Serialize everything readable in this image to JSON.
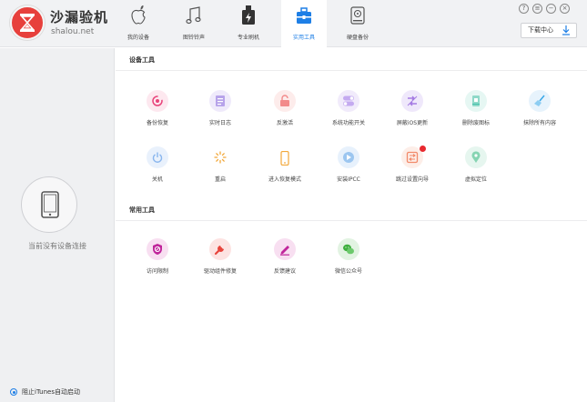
{
  "app": {
    "title": "沙漏验机",
    "url": "shalou.net"
  },
  "nav": {
    "tabs": [
      {
        "label": "我的设备",
        "icon": "apple-icon"
      },
      {
        "label": "图铃铃声",
        "icon": "music-note-icon"
      },
      {
        "label": "专业刷机",
        "icon": "phone-flash-icon"
      },
      {
        "label": "实用工具",
        "icon": "toolbox-icon"
      },
      {
        "label": "硬盘备份",
        "icon": "hard-drive-icon"
      }
    ],
    "active_tab": "实用工具"
  },
  "window_controls": [
    "help-icon",
    "menu-icon",
    "minimize-icon",
    "close-icon"
  ],
  "download_center": {
    "label": "下载中心",
    "icon": "download-icon"
  },
  "sidebar": {
    "device_icon": "tablet-icon",
    "no_device_text": "当前没有设备连接",
    "itunes_option": "阻止iTunes自动启动"
  },
  "sections": {
    "device_tools": {
      "title": "设备工具",
      "tools": [
        {
          "label": "备份恢复",
          "icon": "backup-restore-icon",
          "color": "#e8437a"
        },
        {
          "label": "实时日志",
          "icon": "log-icon",
          "color": "#8b6fd6"
        },
        {
          "label": "反激活",
          "icon": "unlock-icon",
          "color": "#f07a7a"
        },
        {
          "label": "系统功能开关",
          "icon": "toggle-icon",
          "color": "#a57be3"
        },
        {
          "label": "屏蔽iOS更新",
          "icon": "block-update-icon",
          "color": "#9a6fe0"
        },
        {
          "label": "删除废图标",
          "icon": "delete-icon-icon",
          "color": "#3fbfa9"
        },
        {
          "label": "抹除所有内容",
          "icon": "broom-icon",
          "color": "#38a8e8"
        },
        {
          "label": "关机",
          "icon": "power-icon",
          "color": "#6ea2e6"
        },
        {
          "label": "重启",
          "icon": "restart-icon",
          "color": "#f2a83a"
        },
        {
          "label": "进入恢复模式",
          "icon": "recovery-mode-icon",
          "color": "#f2a83a"
        },
        {
          "label": "安装IPCC",
          "icon": "ipcc-icon",
          "color": "#5aa4e6"
        },
        {
          "label": "跳过设置向导",
          "icon": "skip-wizard-icon",
          "color": "#f28a6a",
          "badge": true
        },
        {
          "label": "虚拟定位",
          "icon": "location-icon",
          "color": "#3fb98e"
        }
      ]
    },
    "common_tools": {
      "title": "常用工具",
      "tools": [
        {
          "label": "访问限制",
          "icon": "restriction-icon",
          "color": "#c0269b"
        },
        {
          "label": "驱动组件修复",
          "icon": "repair-icon",
          "color": "#e8443c"
        },
        {
          "label": "反馈建议",
          "icon": "feedback-icon",
          "color": "#c0269b"
        },
        {
          "label": "微信公众号",
          "icon": "wechat-icon",
          "color": "#3caf3c"
        }
      ]
    }
  }
}
